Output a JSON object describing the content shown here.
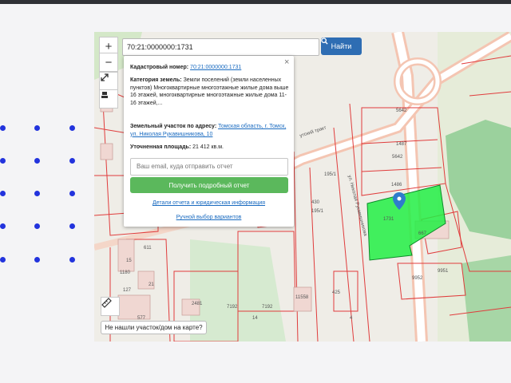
{
  "search": {
    "value": "70:21:0000000:1731",
    "button_label": "Найти"
  },
  "map_controls": {
    "zoom_in": "+",
    "zoom_out": "−"
  },
  "popup": {
    "close_label": "×",
    "cadastral_label": "Кадастровый номер:",
    "cadastral_value": "70:21:0000000:1731",
    "category_label": "Категория земель:",
    "category_value": "Земли поселений (земли населенных пунктов)",
    "usage_text": "Многоквартирные многоэтажные жилые дома выше 16 этажей, многоквартирные многоэтажные жилые дома 11-16 этажей,...",
    "address_label": "Земельный участок по адресу:",
    "address_value": "Томская область, г. Томск, ул. Николая Рукавишникова, 10",
    "area_label": "Уточненная площадь:",
    "area_value": "21 412 кв.м.",
    "email_placeholder": "Ваш email, куда отправить отчет",
    "report_button": "Получить подробный отчет",
    "details_link": "Детали отчета и юридическая информация",
    "manual_link": "Ручной выбор вариантов"
  },
  "map_labels": {
    "street_tract": "утский тракт",
    "street_rukav": "ул. Николая Рукавишникова",
    "n5642a": "5642",
    "n1487": "1487",
    "n5642b": "5642",
    "n1486": "1486",
    "n1731": "1731",
    "n430": "430",
    "n1951": "195/1",
    "n1951b": "195/1",
    "n611": "611",
    "n2481": "2481",
    "n7192a": "7192",
    "n7192b": "7192",
    "n11558": "11558",
    "n425": "425",
    "n9952": "9952",
    "n9951": "9951",
    "n667": "667",
    "n1180": "1180",
    "n14": "14",
    "n577": "577",
    "n127": "127",
    "n21": "21",
    "n15": "15",
    "n4": "4"
  },
  "not_found_label": "Не нашли участок/дом на карте?",
  "colors": {
    "parcel_highlight": "#22ee44",
    "parcel_border": "#e03c3c",
    "search_button": "#2e6db3",
    "report_button": "#5bb85c",
    "link": "#1a6bc0",
    "marker": "#2f7ccc",
    "dots": "#2233dd"
  },
  "icons": {
    "search": "magnifier-icon",
    "fullscreen": "expand-arrows-icon",
    "layers": "layers-icon",
    "ruler": "ruler-icon",
    "marker": "map-pin-icon"
  }
}
